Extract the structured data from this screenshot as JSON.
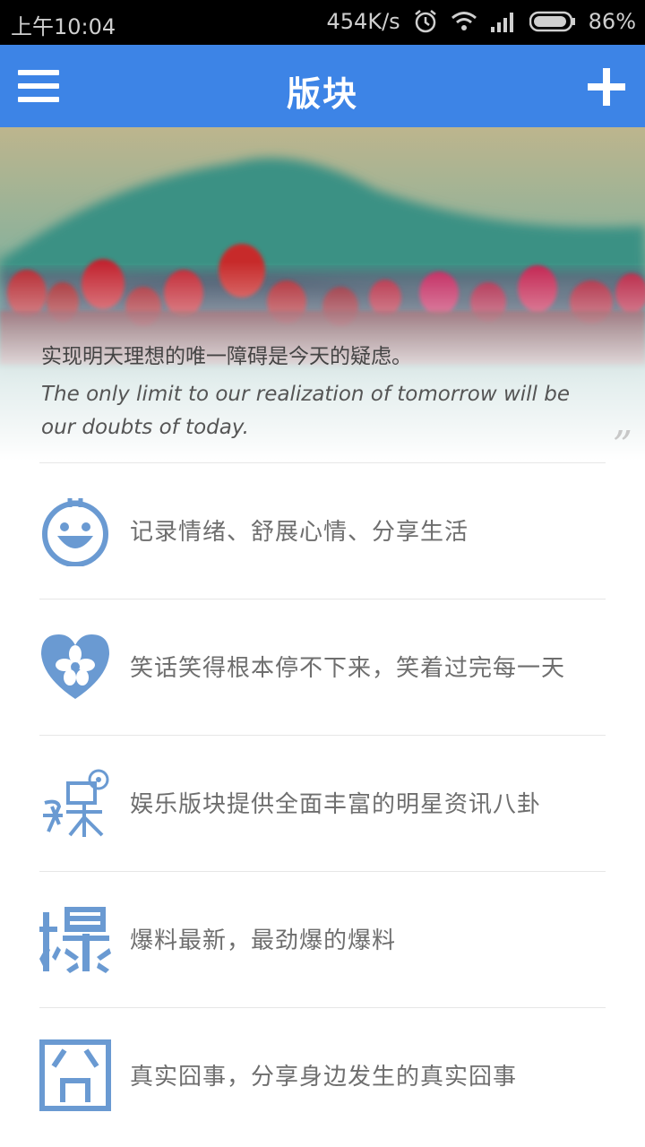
{
  "status_bar": {
    "time": "上午10:04",
    "speed": "454K/s",
    "battery": "86%",
    "icons": [
      "alarm-icon",
      "wifi-icon",
      "signal-icon",
      "battery-icon"
    ]
  },
  "app_bar": {
    "title": "版块",
    "menu_icon": "menu-icon",
    "add_icon": "plus-icon",
    "color": "#3d84e6"
  },
  "banner": {
    "quote_cn": "实现明天理想的唯一障碍是今天的疑虑。",
    "quote_en": "The only limit to our realization of tomorrow will be our doubts of today.",
    "quote_mark": "”"
  },
  "boards": [
    {
      "icon": "smiley-face-icon",
      "label": "记录情绪、舒展心情、分享生活"
    },
    {
      "icon": "heart-flower-icon",
      "label": "笑话笑得根本停不下来，笑着过完每一天"
    },
    {
      "icon": "entertainment-icon",
      "label": "娱乐版块提供全面丰富的明星资讯八卦"
    },
    {
      "icon": "explosion-character-icon",
      "label": "爆料最新，最劲爆的爆料"
    },
    {
      "icon": "embarrassed-character-icon",
      "label": "真实囧事，分享身边发生的真实囧事"
    }
  ],
  "icon_color": "#6a9ad2"
}
